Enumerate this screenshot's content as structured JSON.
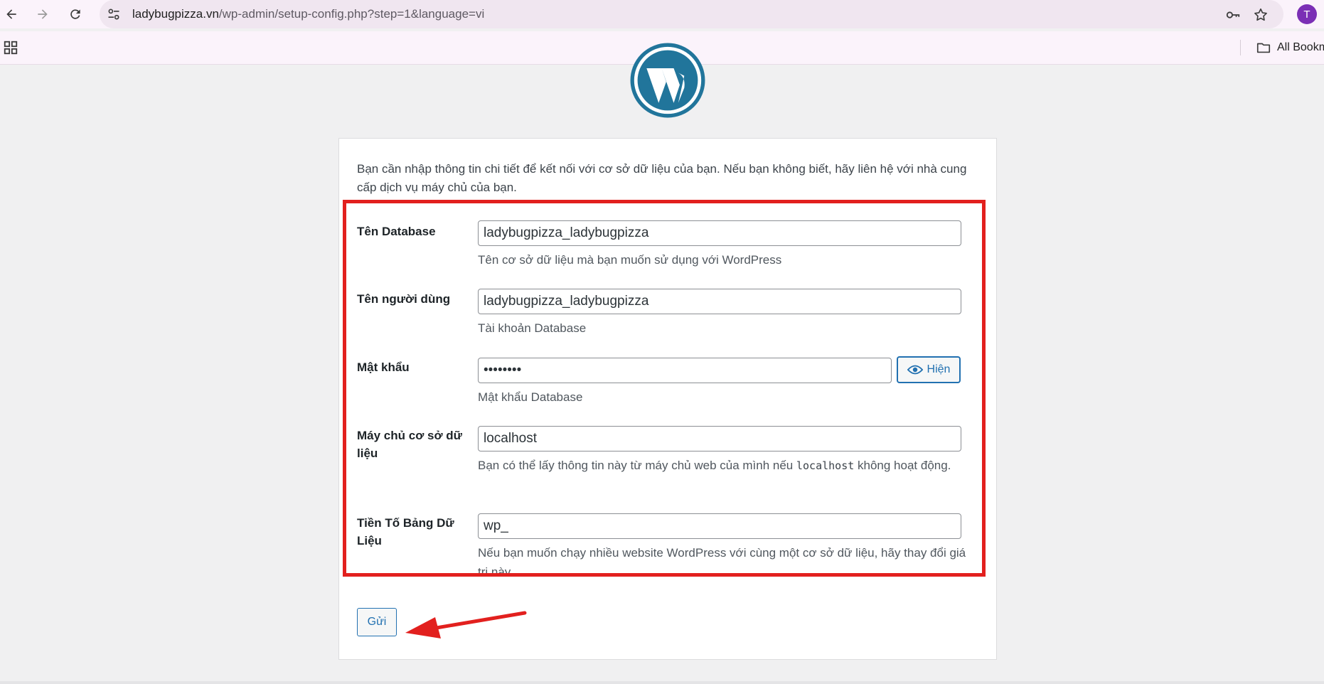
{
  "browser": {
    "url_host": "ladybugpizza.vn",
    "url_path": "/wp-admin/setup-config.php?step=1&language=vi",
    "avatar_letter": "T",
    "bookmarks_label": "All Bookm"
  },
  "page": {
    "intro": "Bạn cần nhập thông tin chi tiết để kết nối với cơ sở dữ liệu của bạn. Nếu bạn không biết, hãy liên hệ với nhà cung cấp dịch vụ máy chủ của bạn.",
    "fields": {
      "dbname": {
        "label": "Tên Database",
        "value": "ladybugpizza_ladybugpizza",
        "desc": "Tên cơ sở dữ liệu mà bạn muốn sử dụng với WordPress"
      },
      "uname": {
        "label": "Tên người dùng",
        "value": "ladybugpizza_ladybugpizza",
        "desc": "Tài khoản Database"
      },
      "pwd": {
        "label": "Mật khẩu",
        "value": "••••••••",
        "desc": "Mật khẩu Database",
        "show_label": "Hiện"
      },
      "dbhost": {
        "label": "Máy chủ cơ sở dữ liệu",
        "value": "localhost",
        "desc_before": "Bạn có thể lấy thông tin này từ máy chủ web của mình nếu",
        "desc_code": "localhost",
        "desc_after": "không hoạt động."
      },
      "prefix": {
        "label": "Tiền Tố Bảng Dữ Liệu",
        "value": "wp_",
        "desc": "Nếu bạn muốn chạy nhiều website WordPress với cùng một cơ sở dữ liệu, hãy thay đổi giá trị này."
      }
    },
    "submit_label": "Gửi"
  },
  "colors": {
    "accent": "#2271b1",
    "highlight": "#e2201e",
    "wordpress_blue": "#21759b"
  }
}
